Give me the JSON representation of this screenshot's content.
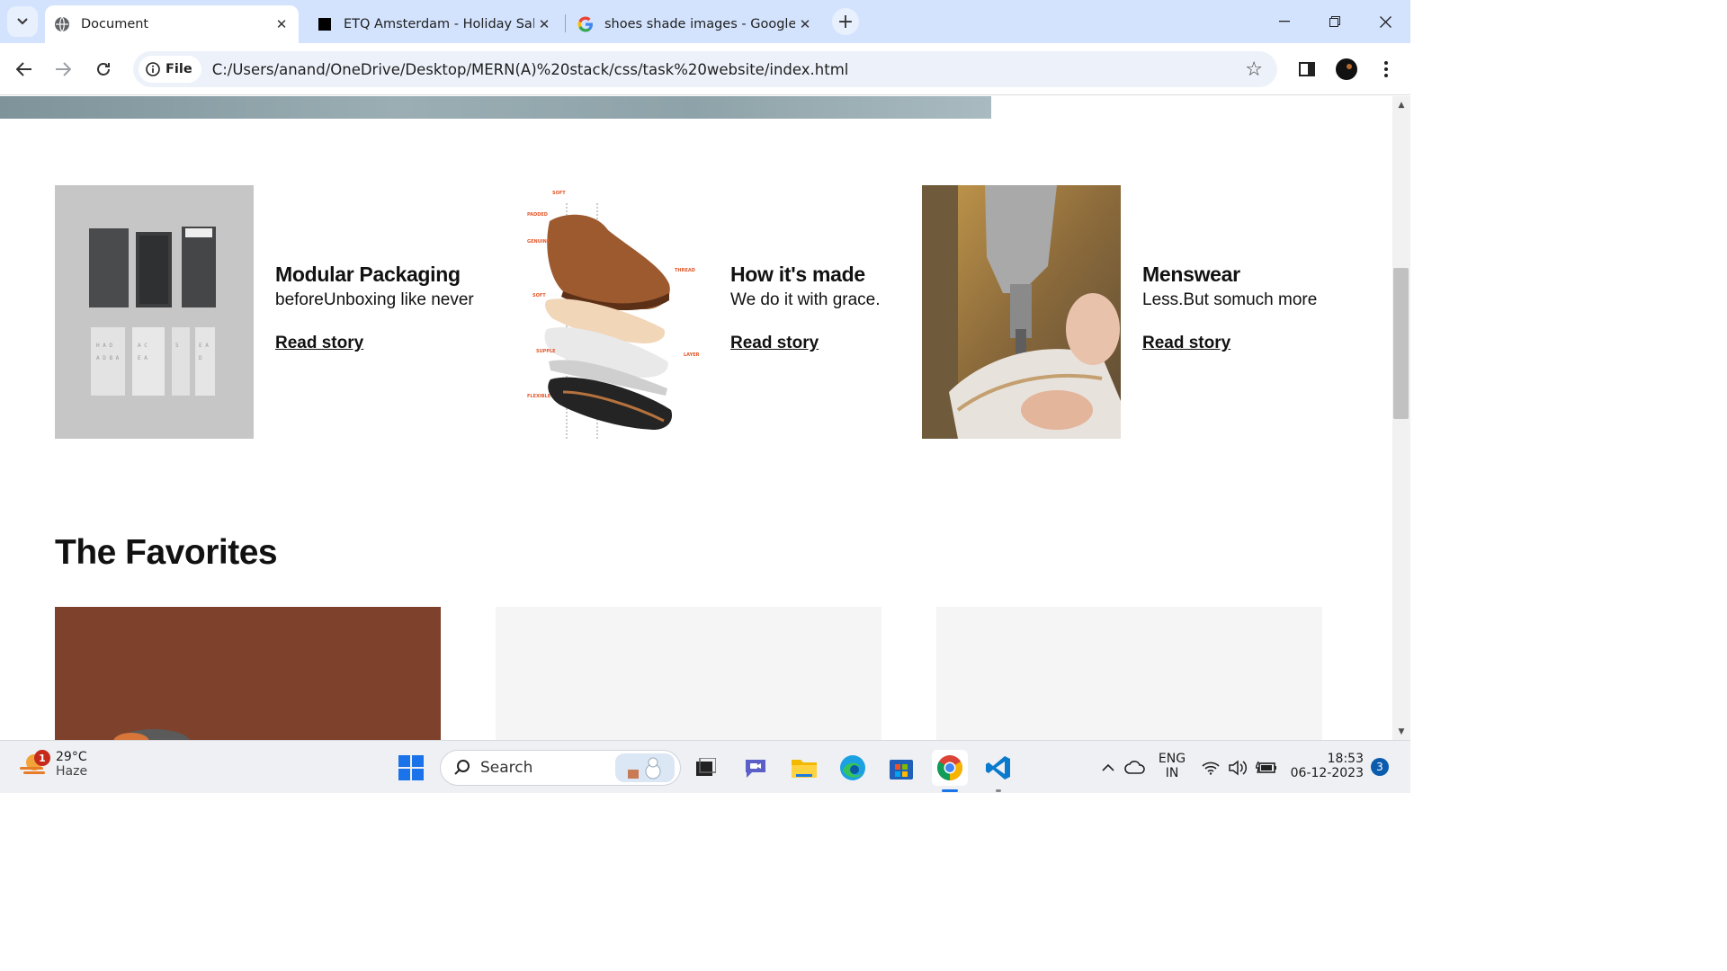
{
  "browser": {
    "tabs": [
      {
        "title": "Document",
        "active": true,
        "favicon": "globe-icon"
      },
      {
        "title": "ETQ Amsterdam - Holiday Sale",
        "active": false,
        "favicon": "etq-square-icon"
      },
      {
        "title": "shoes shade images - Google S",
        "active": false,
        "favicon": "google-g-icon"
      }
    ],
    "security_chip": "File",
    "url": "C:/Users/anand/OneDrive/Desktop/MERN(A)%20stack/css/task%20website/index.html"
  },
  "page": {
    "features": [
      {
        "title": "Modular Packaging",
        "subtitle": "beforeUnboxing like never",
        "link": "Read story",
        "image": "packaging-boxes-image"
      },
      {
        "title": "How it's made",
        "subtitle": "We do it with grace.",
        "link": "Read story",
        "image": "shoe-layers-diagram-image"
      },
      {
        "title": "Menswear",
        "subtitle": "Less.But somuch more",
        "link": "Read story",
        "image": "shoemaking-machine-image"
      }
    ],
    "diagram_labels": {
      "soft_top": "SOFT",
      "padded": "PADDED",
      "genuine": "GENUINE",
      "thread": "THREAD",
      "soft_mid": "SOFT",
      "layer": "LAYER",
      "supple": "SUPPLE",
      "flexible": "FLEXIBLE"
    },
    "favorites_heading": "The Favorites"
  },
  "taskbar": {
    "weather_temp": "29°C",
    "weather_desc": "Haze",
    "weather_badge": "1",
    "search_placeholder": "Search",
    "lang_top": "ENG",
    "lang_bottom": "IN",
    "time": "18:53",
    "date": "06-12-2023",
    "notification_count": "3"
  },
  "colors": {
    "tabstrip_bg": "#d3e3fd",
    "omnibox_bg": "#edf2fa",
    "taskbar_bg": "#eef0f4",
    "favorite_card_1": "#7a3f2a",
    "favorite_card_placeholder": "#f5f5f5"
  }
}
